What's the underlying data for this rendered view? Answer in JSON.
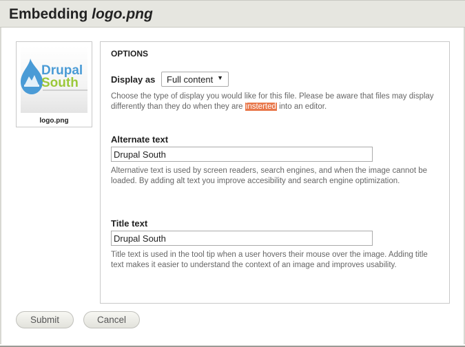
{
  "title": {
    "prefix": "Embedding ",
    "filename": "logo.png"
  },
  "thumbnail": {
    "caption": "logo.png",
    "logo_line1": "Drupal",
    "logo_line2": "South"
  },
  "options": {
    "legend": "OPTIONS",
    "display_as": {
      "label": "Display as",
      "selected": "Full content",
      "desc_before": "Choose the type of display you would like for this file. Please be aware that files may display differently than they do when they are ",
      "desc_highlight": "insterted",
      "desc_after": " into an editor."
    },
    "alt_text": {
      "label": "Alternate text",
      "value": "Drupal South",
      "desc": "Alternative text is used by screen readers, search engines, and when the image cannot be loaded. By adding alt text you improve accesibility and search engine optimization."
    },
    "title_text": {
      "label": "Title text",
      "value": "Drupal South",
      "desc": "Title text is used in the tool tip when a user hovers their mouse over the image. Adding title text makes it easier to understand the context of an image and improves usability."
    }
  },
  "buttons": {
    "submit": "Submit",
    "cancel": "Cancel"
  },
  "colors": {
    "highlight": "#e8774a",
    "logo_blue": "#4a9bd6",
    "logo_green": "#9bc83a"
  }
}
